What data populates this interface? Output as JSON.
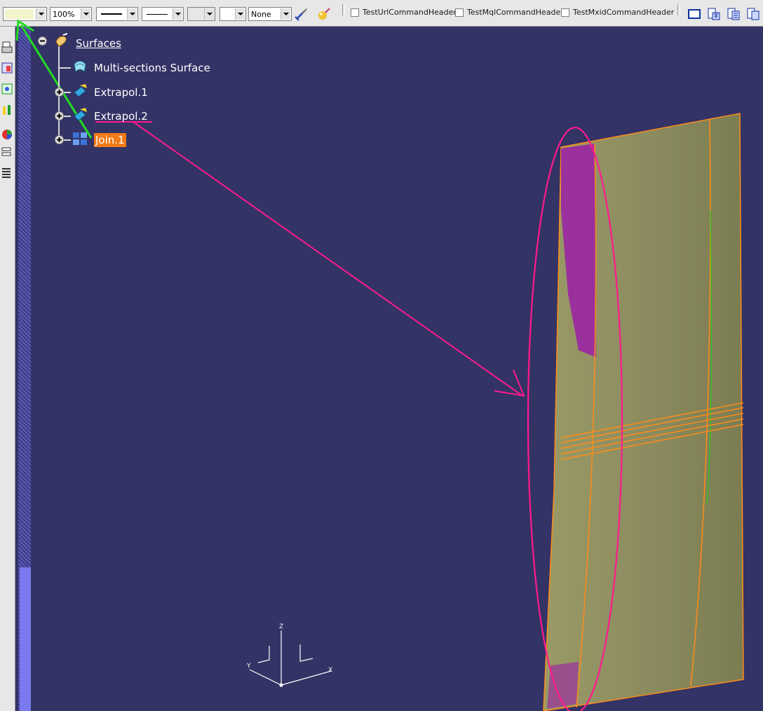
{
  "toolbar": {
    "color_value": "",
    "transparency_value": "100%",
    "linetype_value": "",
    "thickness_value": "",
    "point_value": "",
    "layer_value": "",
    "rendering_value": "None",
    "check_url": "TestUrlCommandHeader",
    "check_mql": "TestMqlCommandHeader",
    "check_mxid": "TestMxidCommandHeader"
  },
  "tree": {
    "root_label": "Surfaces",
    "items": [
      {
        "label": "Multi-sections Surface"
      },
      {
        "label": "Extrapol.1"
      },
      {
        "label": "Extrapol.2"
      },
      {
        "label": "Join.1"
      }
    ]
  },
  "axes": {
    "x": "X",
    "y": "Y",
    "z": "Z"
  },
  "colors": {
    "background": "#333366",
    "selection": "#f07a1a",
    "surface_fill": "#8a8a5c",
    "surface_edge": "#ff8c1a",
    "annotation_magenta": "#ff1a8c",
    "annotation_green": "#22dd22"
  }
}
